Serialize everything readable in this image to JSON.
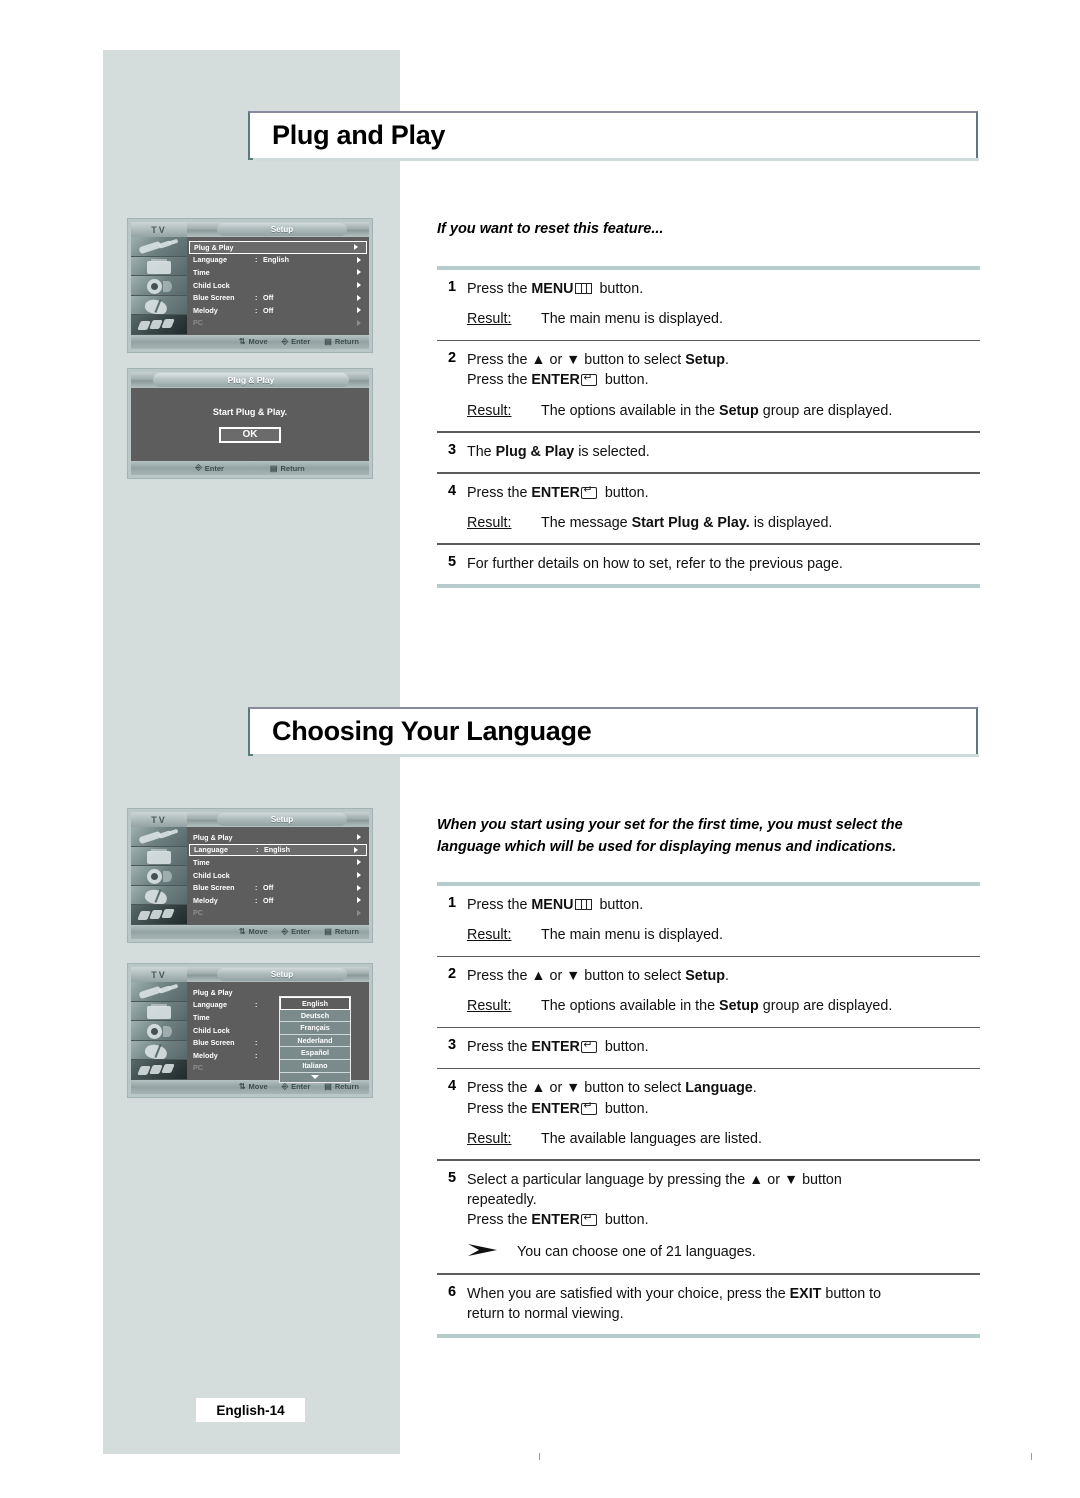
{
  "page": {
    "footer_label": "English-14"
  },
  "sections": [
    {
      "title": "Plug and Play",
      "intro": "If you want to reset this feature...",
      "steps": [
        {
          "num": "1",
          "lines": [
            "Press the MENU ⬜ button."
          ],
          "text_before_kbd": "Press the ",
          "kbd": "MENU",
          "text_after_kbd": " button.",
          "result_label": "Result:",
          "result_text": "The main menu is displayed."
        },
        {
          "num": "2",
          "line1_a": "Press the ▲ or ▼ button to select ",
          "line1_b": "Setup",
          "line1_c": ".",
          "line2_a": "Press the ",
          "line2_kbd": "ENTER",
          "line2_c": " button.",
          "result_label": "Result:",
          "result_a": "The options available in the ",
          "result_b": "Setup",
          "result_c": " group are displayed."
        },
        {
          "num": "3",
          "line1_a": "The ",
          "line1_b": "Plug & Play",
          "line1_c": " is selected."
        },
        {
          "num": "4",
          "line1_a": "Press the ",
          "line1_kbd": "ENTER",
          "line1_c": " button.",
          "result_label": "Result:",
          "result_a": "The message ",
          "result_b": "Start Plug & Play.",
          "result_c": " is displayed."
        },
        {
          "num": "5",
          "line1_a": "For further details on how to set, refer to the previous page."
        }
      ]
    },
    {
      "title": "Choosing Your Language",
      "intro_line1": "When you start using your set for the first time, you must select the",
      "intro_line2": "language which will be used for displaying menus and indications.",
      "steps": [
        {
          "num": "1",
          "text_before_kbd": "Press the ",
          "kbd": "MENU",
          "text_after_kbd": " button.",
          "result_label": "Result:",
          "result_text": "The main menu is displayed."
        },
        {
          "num": "2",
          "line1_a": "Press the ▲ or ▼ button to select ",
          "line1_b": "Setup",
          "line1_c": ".",
          "result_label": "Result:",
          "result_a": "The options available in the ",
          "result_b": "Setup",
          "result_c": " group are displayed."
        },
        {
          "num": "3",
          "line1_a": "Press the ",
          "line1_kbd": "ENTER",
          "line1_c": " button."
        },
        {
          "num": "4",
          "line1_a": "Press the ▲ or ▼ button to select ",
          "line1_b": "Language",
          "line1_c": ".",
          "line2_a": "Press the ",
          "line2_kbd": "ENTER",
          "line2_c": " button.",
          "result_label": "Result:",
          "result_text": "The available languages are listed."
        },
        {
          "num": "5",
          "line1_a": "Select a particular language by pressing the ▲ or ▼ button",
          "line2_a": "repeatedly.",
          "line3_a": "Press the ",
          "line3_kbd": "ENTER",
          "line3_c": " button.",
          "note": "You can choose one of 21 languages."
        },
        {
          "num": "6",
          "line1_a": "When you are satisfied with your choice, press the ",
          "line1_b": "EXIT",
          "line1_c": " button to",
          "line2_a": "return to normal viewing."
        }
      ]
    }
  ],
  "osd": {
    "tv_label": "TV",
    "setup_tab": "Setup",
    "plugplay_tab": "Plug & Play",
    "menu_rows": [
      {
        "label": "Plug & Play",
        "colon": "",
        "value": ""
      },
      {
        "label": "Language",
        "colon": ":",
        "value": "English"
      },
      {
        "label": "Time",
        "colon": "",
        "value": ""
      },
      {
        "label": "Child Lock",
        "colon": "",
        "value": ""
      },
      {
        "label": "Blue Screen",
        "colon": ":",
        "value": "Off"
      },
      {
        "label": "Melody",
        "colon": ":",
        "value": "Off"
      },
      {
        "label": "PC",
        "colon": "",
        "value": ""
      }
    ],
    "footer": {
      "move": "Move",
      "enter": "Enter",
      "return": "Return"
    },
    "dialog": {
      "message": "Start Plug & Play.",
      "ok": "OK",
      "enter": "Enter",
      "return": "Return"
    },
    "languages": [
      "English",
      "Deutsch",
      "Français",
      "Nederland",
      "Español",
      "Italiano"
    ],
    "language_selected": "English"
  },
  "colors": {
    "panel_grey": "#d4dcdc",
    "title_border": "#5b7b7b",
    "rule_light": "#b6cbcb",
    "rule_dark": "#5c5c5c",
    "osd_body": "#5d5d5d"
  }
}
